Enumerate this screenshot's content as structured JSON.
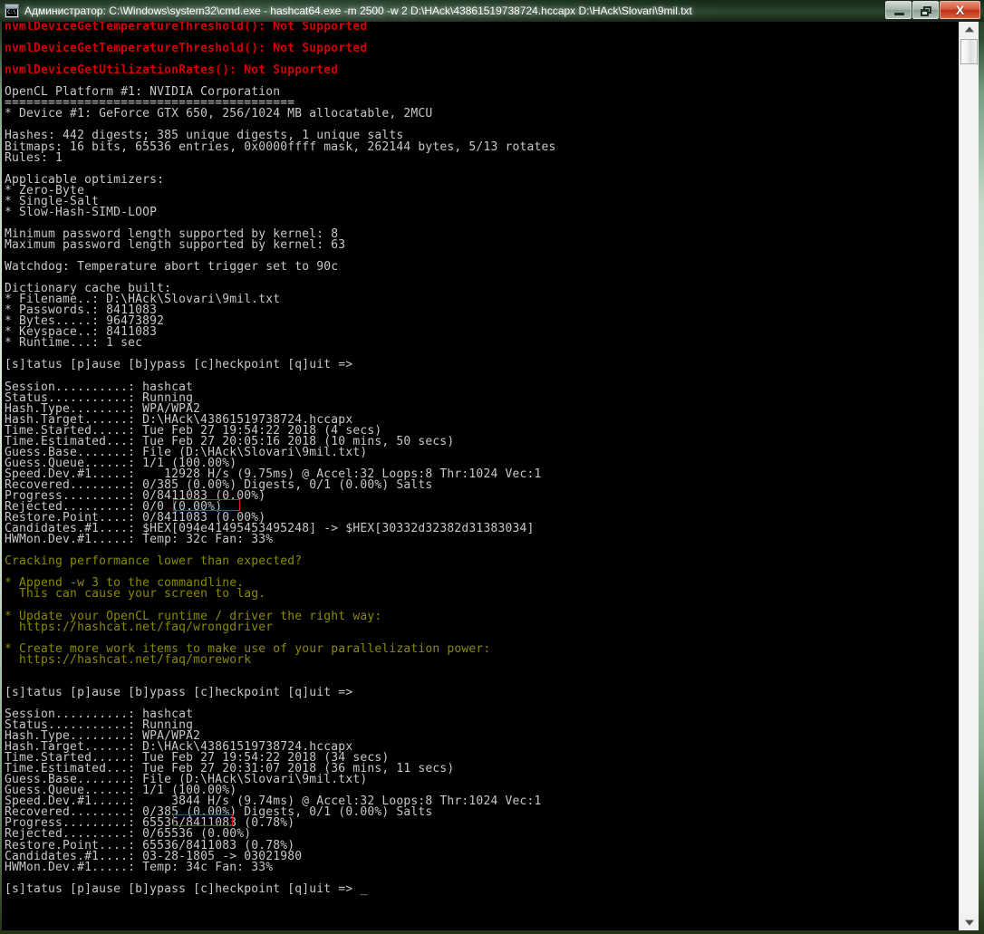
{
  "window": {
    "title": "Администратор: C:\\Windows\\system32\\cmd.exe - hashcat64.exe  -m 2500 -w 2 D:\\HAck\\43861519738724.hccapx D:\\HAck\\Slovari\\9mil.txt",
    "icon": "cmd-console-icon",
    "icon_label": "C:\\.",
    "buttons": {
      "minimize": "minimize-button",
      "restore": "restore-button",
      "close_glyph": "X"
    }
  },
  "scrollbar": {
    "up_arrow": "scroll-up-arrow",
    "down_arrow": "scroll-down-arrow",
    "thumb": "scroll-thumb"
  },
  "colors": {
    "error_red": "#d40000",
    "warning_olive": "#8a8a00",
    "console_text": "#c6c6c6",
    "console_bg": "#000000",
    "annotation_box": "#ee1111"
  },
  "console": {
    "lines": [
      {
        "t": "nvmlDeviceGetTemperatureThreshold(): Not Supported",
        "c": "red"
      },
      {
        "t": "",
        "c": "white"
      },
      {
        "t": "nvmlDeviceGetTemperatureThreshold(): Not Supported",
        "c": "red"
      },
      {
        "t": "",
        "c": "white"
      },
      {
        "t": "nvmlDeviceGetUtilizationRates(): Not Supported",
        "c": "red"
      },
      {
        "t": "",
        "c": "white"
      },
      {
        "t": "OpenCL Platform #1: NVIDIA Corporation",
        "c": "white"
      },
      {
        "t": "========================================",
        "c": "white"
      },
      {
        "t": "* Device #1: GeForce GTX 650, 256/1024 MB allocatable, 2MCU",
        "c": "white"
      },
      {
        "t": "",
        "c": "white"
      },
      {
        "t": "Hashes: 442 digests; 385 unique digests, 1 unique salts",
        "c": "white"
      },
      {
        "t": "Bitmaps: 16 bits, 65536 entries, 0x0000ffff mask, 262144 bytes, 5/13 rotates",
        "c": "white"
      },
      {
        "t": "Rules: 1",
        "c": "white"
      },
      {
        "t": "",
        "c": "white"
      },
      {
        "t": "Applicable optimizers:",
        "c": "white"
      },
      {
        "t": "* Zero-Byte",
        "c": "white"
      },
      {
        "t": "* Single-Salt",
        "c": "white"
      },
      {
        "t": "* Slow-Hash-SIMD-LOOP",
        "c": "white"
      },
      {
        "t": "",
        "c": "white"
      },
      {
        "t": "Minimum password length supported by kernel: 8",
        "c": "white"
      },
      {
        "t": "Maximum password length supported by kernel: 63",
        "c": "white"
      },
      {
        "t": "",
        "c": "white"
      },
      {
        "t": "Watchdog: Temperature abort trigger set to 90c",
        "c": "white"
      },
      {
        "t": "",
        "c": "white"
      },
      {
        "t": "Dictionary cache built:",
        "c": "white"
      },
      {
        "t": "* Filename..: D:\\HAck\\Slovari\\9mil.txt",
        "c": "white"
      },
      {
        "t": "* Passwords.: 8411083",
        "c": "white"
      },
      {
        "t": "* Bytes.....: 96473892",
        "c": "white"
      },
      {
        "t": "* Keyspace..: 8411083",
        "c": "white"
      },
      {
        "t": "* Runtime...: 1 sec",
        "c": "white"
      },
      {
        "t": "",
        "c": "white"
      },
      {
        "t": "[s]tatus [p]ause [b]ypass [c]heckpoint [q]uit =>",
        "c": "white"
      },
      {
        "t": "",
        "c": "white"
      },
      {
        "t": "Session..........: hashcat",
        "c": "white"
      },
      {
        "t": "Status...........: Running",
        "c": "white"
      },
      {
        "t": "Hash.Type........: WPA/WPA2",
        "c": "white"
      },
      {
        "t": "Hash.Target......: D:\\HAck\\43861519738724.hccapx",
        "c": "white"
      },
      {
        "t": "Time.Started.....: Tue Feb 27 19:54:22 2018 (4 secs)",
        "c": "white"
      },
      {
        "t": "Time.Estimated...: Tue Feb 27 20:05:16 2018 (10 mins, 50 secs)",
        "c": "white"
      },
      {
        "t": "Guess.Base.......: File (D:\\HAck\\Slovari\\9mil.txt)",
        "c": "white"
      },
      {
        "t": "Guess.Queue......: 1/1 (100.00%)",
        "c": "white"
      },
      {
        "t": "Speed.Dev.#1.....:    12928 H/s (9.75ms) @ Accel:32 Loops:8 Thr:1024 Vec:1",
        "c": "white"
      },
      {
        "t": "Recovered........: 0/385 (0.00%) Digests, 0/1 (0.00%) Salts",
        "c": "white"
      },
      {
        "t": "Progress.........: 0/8411083 (0.00%)",
        "c": "white"
      },
      {
        "t": "Rejected.........: 0/0 (0.00%)",
        "c": "white"
      },
      {
        "t": "Restore.Point....: 0/8411083 (0.00%)",
        "c": "white"
      },
      {
        "t": "Candidates.#1....: $HEX[094e41495453495248] -> $HEX[30332d32382d31383034]",
        "c": "white"
      },
      {
        "t": "HWMon.Dev.#1.....: Temp: 32c Fan: 33%",
        "c": "white"
      },
      {
        "t": "",
        "c": "white"
      },
      {
        "t": "Cracking performance lower than expected?",
        "c": "olive"
      },
      {
        "t": "",
        "c": "white"
      },
      {
        "t": "* Append -w 3 to the commandline.",
        "c": "olive"
      },
      {
        "t": "  This can cause your screen to lag.",
        "c": "olive"
      },
      {
        "t": "",
        "c": "white"
      },
      {
        "t": "* Update your OpenCL runtime / driver the right way:",
        "c": "olive"
      },
      {
        "t": "  https://hashcat.net/faq/wrongdriver",
        "c": "olive"
      },
      {
        "t": "",
        "c": "white"
      },
      {
        "t": "* Create more work items to make use of your parallelization power:",
        "c": "olive"
      },
      {
        "t": "  https://hashcat.net/faq/morework",
        "c": "olive"
      },
      {
        "t": "",
        "c": "white"
      },
      {
        "t": "",
        "c": "white"
      },
      {
        "t": "[s]tatus [p]ause [b]ypass [c]heckpoint [q]uit =>",
        "c": "white"
      },
      {
        "t": "",
        "c": "white"
      },
      {
        "t": "Session..........: hashcat",
        "c": "white"
      },
      {
        "t": "Status...........: Running",
        "c": "white"
      },
      {
        "t": "Hash.Type........: WPA/WPA2",
        "c": "white"
      },
      {
        "t": "Hash.Target......: D:\\HAck\\43861519738724.hccapx",
        "c": "white"
      },
      {
        "t": "Time.Started.....: Tue Feb 27 19:54:22 2018 (34 secs)",
        "c": "white"
      },
      {
        "t": "Time.Estimated...: Tue Feb 27 20:31:07 2018 (36 mins, 11 secs)",
        "c": "white"
      },
      {
        "t": "Guess.Base.......: File (D:\\HAck\\Slovari\\9mil.txt)",
        "c": "white"
      },
      {
        "t": "Guess.Queue......: 1/1 (100.00%)",
        "c": "white"
      },
      {
        "t": "Speed.Dev.#1.....:     3844 H/s (9.74ms) @ Accel:32 Loops:8 Thr:1024 Vec:1",
        "c": "white"
      },
      {
        "t": "Recovered........: 0/385 (0.00%) Digests, 0/1 (0.00%) Salts",
        "c": "white"
      },
      {
        "t": "Progress.........: 65536/8411083 (0.78%)",
        "c": "white"
      },
      {
        "t": "Rejected.........: 0/65536 (0.00%)",
        "c": "white"
      },
      {
        "t": "Restore.Point....: 65536/8411083 (0.78%)",
        "c": "white"
      },
      {
        "t": "Candidates.#1....: 03-28-1805 -> 03021980",
        "c": "white"
      },
      {
        "t": "HWMon.Dev.#1.....: Temp: 34c Fan: 33%",
        "c": "white"
      },
      {
        "t": "",
        "c": "white"
      },
      {
        "t": "[s]tatus [p]ause [b]ypass [c]heckpoint [q]uit => _",
        "c": "white"
      }
    ],
    "annotations": [
      {
        "name": "speed-highlight-1",
        "text": "12928 H/s"
      },
      {
        "name": "speed-highlight-2",
        "text": "3844 H/s"
      }
    ]
  }
}
